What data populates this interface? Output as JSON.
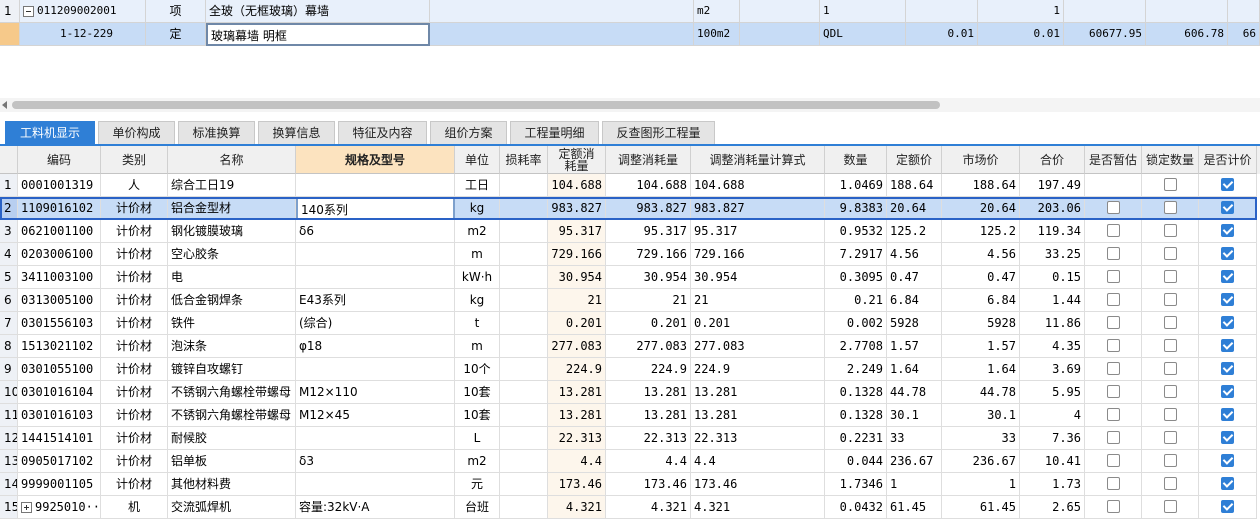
{
  "upper": {
    "row1": {
      "num": "1",
      "code": "011209002001",
      "type": "项",
      "name": "全玻（无框玻璃）幕墙",
      "c4": "",
      "unit": "m2",
      "c6": "",
      "c7": "1",
      "c8": "",
      "c9": "1",
      "c10": "",
      "c11": "",
      "c12": ""
    },
    "row2": {
      "num": "",
      "code": "1-12-229",
      "type": "定",
      "name": "玻璃幕墙 明框",
      "c4": "",
      "unit": "100m2",
      "c6": "",
      "c7": "QDL",
      "c8": "0.01",
      "c9": "0.01",
      "c10": "60677.95",
      "c11": "606.78",
      "c12": "66"
    }
  },
  "tabs": [
    "工料机显示",
    "单价构成",
    "标准换算",
    "换算信息",
    "特征及内容",
    "组价方案",
    "工程量明细",
    "反查图形工程量"
  ],
  "headers": [
    "编码",
    "类别",
    "名称",
    "规格及型号",
    "单位",
    "损耗率",
    "定额消耗量",
    "调整消耗量",
    "调整消耗量计算式",
    "数量",
    "定额价",
    "市场价",
    "合价",
    "是否暂估",
    "锁定数量",
    "是否计价"
  ],
  "rows": [
    {
      "n": "1",
      "code": "0001001319",
      "cat": "人",
      "name": "综合工日19",
      "spec": "",
      "unit": "工日",
      "loss": "",
      "q": "104.688",
      "adj": "104.688",
      "formula": "104.688",
      "qty": "1.0469",
      "qp": "188.64",
      "mp": "188.64",
      "total": "197.49",
      "est": null,
      "lock": false,
      "price": true
    },
    {
      "n": "2",
      "code": "1109016102",
      "cat": "计价材",
      "name": "铝合金型材",
      "spec": "140系列",
      "unit": "kg",
      "loss": "",
      "q": "983.827",
      "adj": "983.827",
      "formula": "983.827",
      "qty": "9.8383",
      "qp": "20.64",
      "mp": "20.64",
      "total": "203.06",
      "est": false,
      "lock": false,
      "price": true
    },
    {
      "n": "3",
      "code": "0621001100",
      "cat": "计价材",
      "name": "钢化镀膜玻璃",
      "spec": "δ6",
      "unit": "m2",
      "loss": "",
      "q": "95.317",
      "adj": "95.317",
      "formula": "95.317",
      "qty": "0.9532",
      "qp": "125.2",
      "mp": "125.2",
      "total": "119.34",
      "est": false,
      "lock": false,
      "price": true
    },
    {
      "n": "4",
      "code": "0203006100",
      "cat": "计价材",
      "name": "空心胶条",
      "spec": "",
      "unit": "m",
      "loss": "",
      "q": "729.166",
      "adj": "729.166",
      "formula": "729.166",
      "qty": "7.2917",
      "qp": "4.56",
      "mp": "4.56",
      "total": "33.25",
      "est": false,
      "lock": false,
      "price": true
    },
    {
      "n": "5",
      "code": "3411003100",
      "cat": "计价材",
      "name": "电",
      "spec": "",
      "unit": "kW·h",
      "loss": "",
      "q": "30.954",
      "adj": "30.954",
      "formula": "30.954",
      "qty": "0.3095",
      "qp": "0.47",
      "mp": "0.47",
      "total": "0.15",
      "est": false,
      "lock": false,
      "price": true
    },
    {
      "n": "6",
      "code": "0313005100",
      "cat": "计价材",
      "name": "低合金钢焊条",
      "spec": "E43系列",
      "unit": "kg",
      "loss": "",
      "q": "21",
      "adj": "21",
      "formula": "21",
      "qty": "0.21",
      "qp": "6.84",
      "mp": "6.84",
      "total": "1.44",
      "est": false,
      "lock": false,
      "price": true
    },
    {
      "n": "7",
      "code": "0301556103",
      "cat": "计价材",
      "name": "铁件",
      "spec": "(综合)",
      "unit": "t",
      "loss": "",
      "q": "0.201",
      "adj": "0.201",
      "formula": "0.201",
      "qty": "0.002",
      "qp": "5928",
      "mp": "5928",
      "total": "11.86",
      "est": false,
      "lock": false,
      "price": true
    },
    {
      "n": "8",
      "code": "1513021102",
      "cat": "计价材",
      "name": "泡沫条",
      "spec": "φ18",
      "unit": "m",
      "loss": "",
      "q": "277.083",
      "adj": "277.083",
      "formula": "277.083",
      "qty": "2.7708",
      "qp": "1.57",
      "mp": "1.57",
      "total": "4.35",
      "est": false,
      "lock": false,
      "price": true
    },
    {
      "n": "9",
      "code": "0301055100",
      "cat": "计价材",
      "name": "镀锌自攻螺钉",
      "spec": "",
      "unit": "10个",
      "loss": "",
      "q": "224.9",
      "adj": "224.9",
      "formula": "224.9",
      "qty": "2.249",
      "qp": "1.64",
      "mp": "1.64",
      "total": "3.69",
      "est": false,
      "lock": false,
      "price": true
    },
    {
      "n": "10",
      "code": "0301016104",
      "cat": "计价材",
      "name": "不锈钢六角螺栓带螺母",
      "spec": "M12×110",
      "unit": "10套",
      "loss": "",
      "q": "13.281",
      "adj": "13.281",
      "formula": "13.281",
      "qty": "0.1328",
      "qp": "44.78",
      "mp": "44.78",
      "total": "5.95",
      "est": false,
      "lock": false,
      "price": true
    },
    {
      "n": "11",
      "code": "0301016103",
      "cat": "计价材",
      "name": "不锈钢六角螺栓带螺母",
      "spec": "M12×45",
      "unit": "10套",
      "loss": "",
      "q": "13.281",
      "adj": "13.281",
      "formula": "13.281",
      "qty": "0.1328",
      "qp": "30.1",
      "mp": "30.1",
      "total": "4",
      "est": false,
      "lock": false,
      "price": true
    },
    {
      "n": "12",
      "code": "1441514101",
      "cat": "计价材",
      "name": "耐候胶",
      "spec": "",
      "unit": "L",
      "loss": "",
      "q": "22.313",
      "adj": "22.313",
      "formula": "22.313",
      "qty": "0.2231",
      "qp": "33",
      "mp": "33",
      "total": "7.36",
      "est": false,
      "lock": false,
      "price": true
    },
    {
      "n": "13",
      "code": "0905017102",
      "cat": "计价材",
      "name": "铝单板",
      "spec": "δ3",
      "unit": "m2",
      "loss": "",
      "q": "4.4",
      "adj": "4.4",
      "formula": "4.4",
      "qty": "0.044",
      "qp": "236.67",
      "mp": "236.67",
      "total": "10.41",
      "est": false,
      "lock": false,
      "price": true
    },
    {
      "n": "14",
      "code": "9999001105",
      "cat": "计价材",
      "name": "其他材料费",
      "spec": "",
      "unit": "元",
      "loss": "",
      "q": "173.46",
      "adj": "173.46",
      "formula": "173.46",
      "qty": "1.7346",
      "qp": "1",
      "mp": "1",
      "total": "1.73",
      "est": false,
      "lock": false,
      "price": true
    },
    {
      "n": "15",
      "code": "9925010···",
      "cat": "机",
      "name": "交流弧焊机",
      "spec": "容量:32kV·A",
      "unit": "台班",
      "loss": "",
      "q": "4.321",
      "adj": "4.321",
      "formula": "4.321",
      "qty": "0.0432",
      "qp": "61.45",
      "mp": "61.45",
      "total": "2.65",
      "est": false,
      "lock": false,
      "price": true
    }
  ]
}
